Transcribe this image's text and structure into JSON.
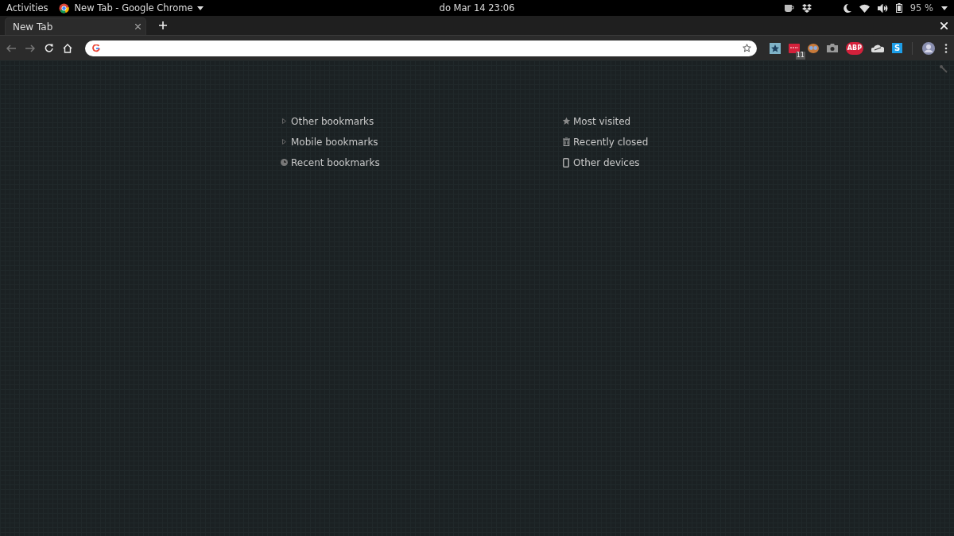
{
  "top_bar": {
    "activities": "Activities",
    "app_title": "New Tab - Google Chrome",
    "clock": "do Mar 14  23:06",
    "battery": "95 %"
  },
  "tabs": [
    {
      "label": "New Tab",
      "selected": true
    }
  ],
  "toolbar": {
    "extensions": [
      {
        "kind": "star"
      },
      {
        "kind": "badge",
        "badge": "11"
      },
      {
        "kind": "owl"
      },
      {
        "kind": "camera"
      },
      {
        "kind": "abp",
        "text": "ABP"
      },
      {
        "kind": "cloud"
      },
      {
        "kind": "letter",
        "text": "S"
      }
    ]
  },
  "bookmark_sections": [
    {
      "label": "Other bookmarks",
      "kind": "folder"
    },
    {
      "label": "Mobile bookmarks",
      "kind": "folder"
    },
    {
      "label": "Recent bookmarks",
      "kind": "recent"
    }
  ],
  "other_sections": [
    {
      "label": "Most visited",
      "kind": "visited"
    },
    {
      "label": "Recently closed",
      "kind": "closed"
    },
    {
      "label": "Other devices",
      "kind": "devices"
    }
  ]
}
